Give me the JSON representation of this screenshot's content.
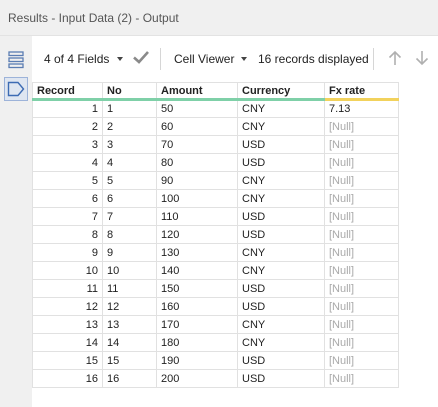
{
  "window": {
    "title": "Results - Input Data (2) - Output"
  },
  "toolbar": {
    "fields_label": "4 of 4 Fields",
    "viewer_label": "Cell Viewer",
    "records_label": "16 records displayed"
  },
  "icons": {
    "grid": "list-view-icon",
    "metadata": "metadata-tag-icon",
    "check": "checkmark-icon",
    "up": "arrow-up-icon",
    "down": "arrow-down-icon"
  },
  "colors": {
    "header_accent": "#7fd0a8",
    "fx_accent": "#f2d25c",
    "null_text": "#a9a9a9"
  },
  "table": {
    "headers": [
      "Record",
      "No",
      "Amount",
      "Currency",
      "Fx rate"
    ],
    "rows": [
      [
        "1",
        "1",
        "50",
        "CNY",
        "7.13"
      ],
      [
        "2",
        "2",
        "60",
        "CNY",
        "[Null]"
      ],
      [
        "3",
        "3",
        "70",
        "USD",
        "[Null]"
      ],
      [
        "4",
        "4",
        "80",
        "USD",
        "[Null]"
      ],
      [
        "5",
        "5",
        "90",
        "CNY",
        "[Null]"
      ],
      [
        "6",
        "6",
        "100",
        "CNY",
        "[Null]"
      ],
      [
        "7",
        "7",
        "110",
        "USD",
        "[Null]"
      ],
      [
        "8",
        "8",
        "120",
        "USD",
        "[Null]"
      ],
      [
        "9",
        "9",
        "130",
        "CNY",
        "[Null]"
      ],
      [
        "10",
        "10",
        "140",
        "CNY",
        "[Null]"
      ],
      [
        "11",
        "11",
        "150",
        "USD",
        "[Null]"
      ],
      [
        "12",
        "12",
        "160",
        "USD",
        "[Null]"
      ],
      [
        "13",
        "13",
        "170",
        "CNY",
        "[Null]"
      ],
      [
        "14",
        "14",
        "180",
        "CNY",
        "[Null]"
      ],
      [
        "15",
        "15",
        "190",
        "USD",
        "[Null]"
      ],
      [
        "16",
        "16",
        "200",
        "USD",
        "[Null]"
      ]
    ]
  }
}
